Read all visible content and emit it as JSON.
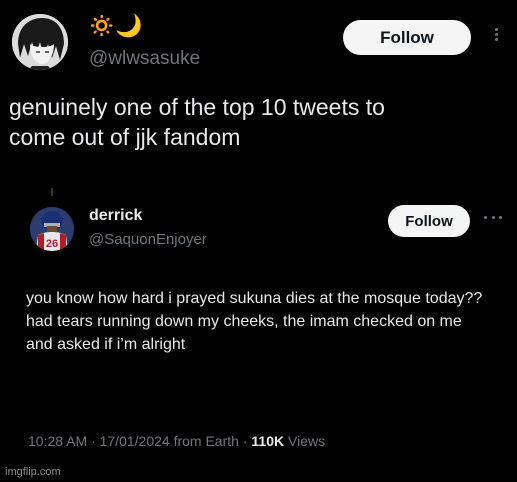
{
  "outer_tweet": {
    "display_name": "🔅🌙",
    "handle": "@wlwsasuke",
    "follow_label": "Follow",
    "text": "genuinely one of the top 10 tweets to come out of jjk fandom"
  },
  "inner_tweet": {
    "display_name": "derrick",
    "handle": "@SaquonEnjoyer",
    "follow_label": "Follow",
    "text": "you know how hard i prayed sukuna dies at the mosque today??  had tears running down my cheeks, the imam checked on me and asked if i’m alright",
    "meta": {
      "time": "10:28 AM",
      "separator": " · ",
      "date": "17/01/2024",
      "source": "from Earth",
      "views_count": "110K",
      "views_label": "Views"
    },
    "jersey_number": "26"
  },
  "watermark": "imgflip.com",
  "colors": {
    "background": "#000000",
    "text_primary": "#e7e9ea",
    "text_secondary": "#71767b",
    "follow_button_bg": "#f5f5f5",
    "follow_button_text": "#0f1419",
    "sun_icon": "#f0a020",
    "moon_icon": "#f5b400"
  },
  "icons": {
    "outer_avatar": "anime-avatar",
    "inner_avatar": "football-player-avatar",
    "more_outer": "more-vertical-icon",
    "more_inner": "more-horizontal-icon"
  }
}
